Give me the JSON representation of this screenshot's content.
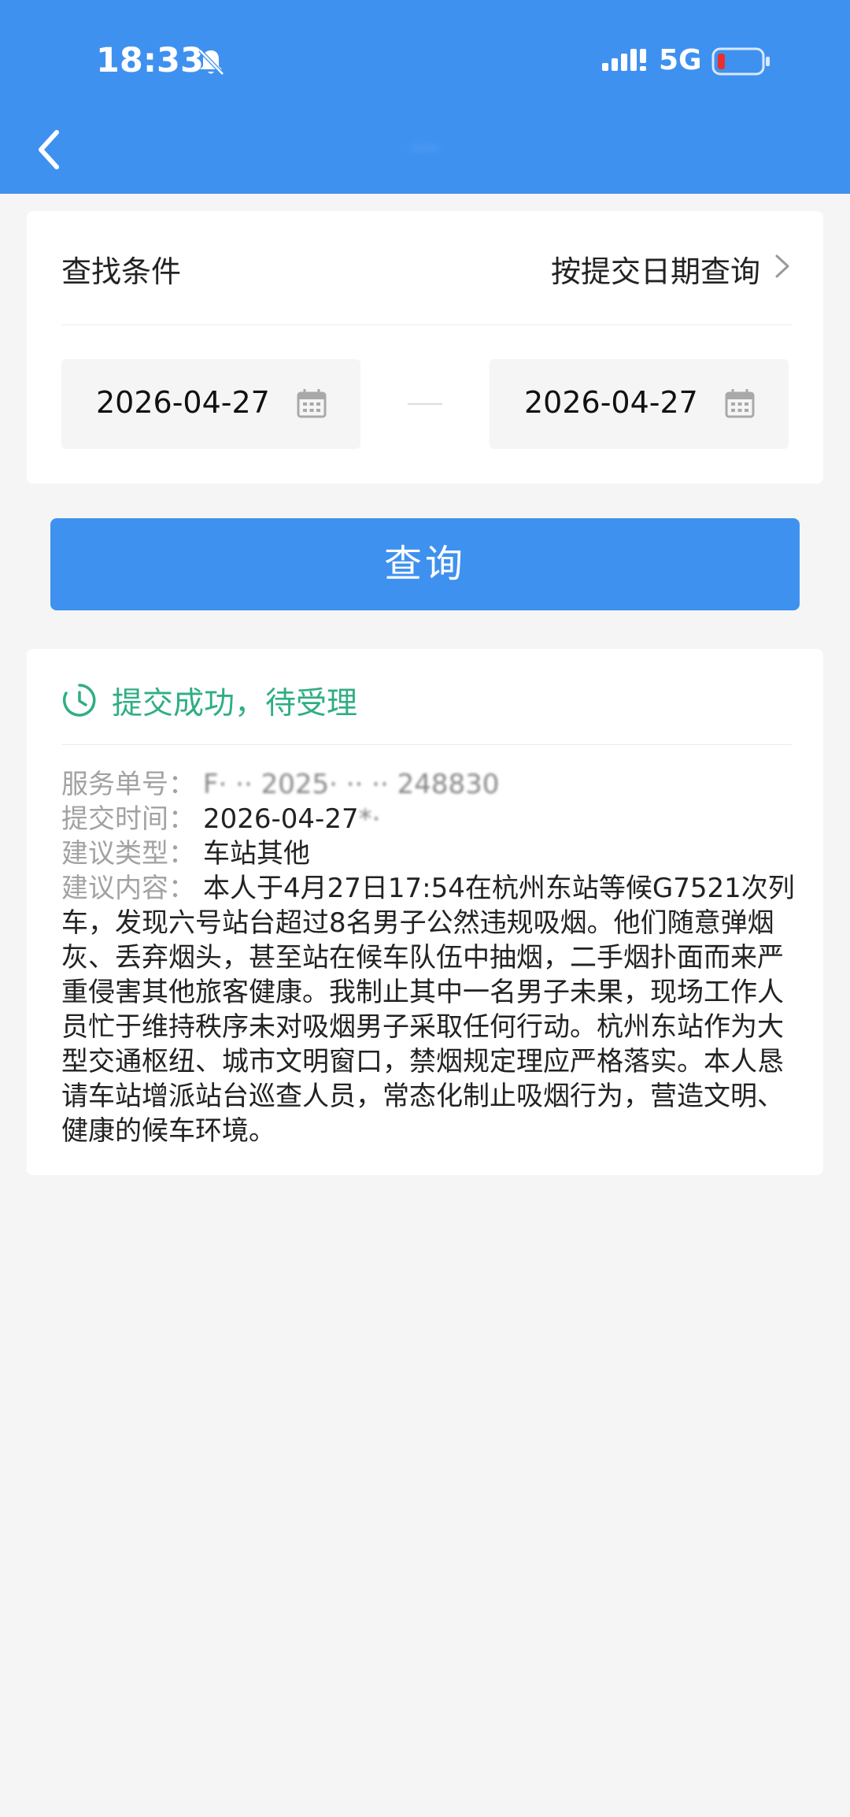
{
  "status_bar": {
    "time": "18:33",
    "network": "5G"
  },
  "header": {
    "title": "···"
  },
  "query": {
    "criteria_label": "查找条件",
    "criteria_value": "按提交日期查询",
    "start_date": "2026-04-27",
    "end_date": "2026-04-27",
    "button_label": "查询"
  },
  "result": {
    "status": "提交成功，待受理",
    "service_no_label": "服务单号：",
    "service_no_value": "F· ·· 2025· ·· ·· 248830",
    "submit_time_label": "提交时间：",
    "submit_time_value": "2026-04-27 ",
    "submit_time_masked": "*·",
    "type_label": "建议类型：",
    "type_value": "车站其他",
    "content_label": "建议内容：",
    "content_value": "本人于4月27日17:54在杭州东站等候G7521次列车，发现六号站台超过8名男子公然违规吸烟。他们随意弹烟灰、丢弃烟头，甚至站在候车队伍中抽烟，二手烟扑面而来严重侵害其他旅客健康。我制止其中一名男子未果，现场工作人员忙于维持秩序未对吸烟男子采取任何行动。杭州东站作为大型交通枢纽、城市文明窗口，禁烟规定理应严格落实。本人恳请车站增派站台巡查人员，常态化制止吸烟行为，营造文明、健康的候车环境。"
  },
  "colors": {
    "primary": "#3f91f0",
    "success": "#2fae84",
    "background": "#f5f5f5"
  },
  "icons": [
    "bell-off-icon",
    "signal-icon",
    "battery-icon",
    "back-icon",
    "chevron-right-icon",
    "calendar-icon",
    "clock-icon"
  ]
}
